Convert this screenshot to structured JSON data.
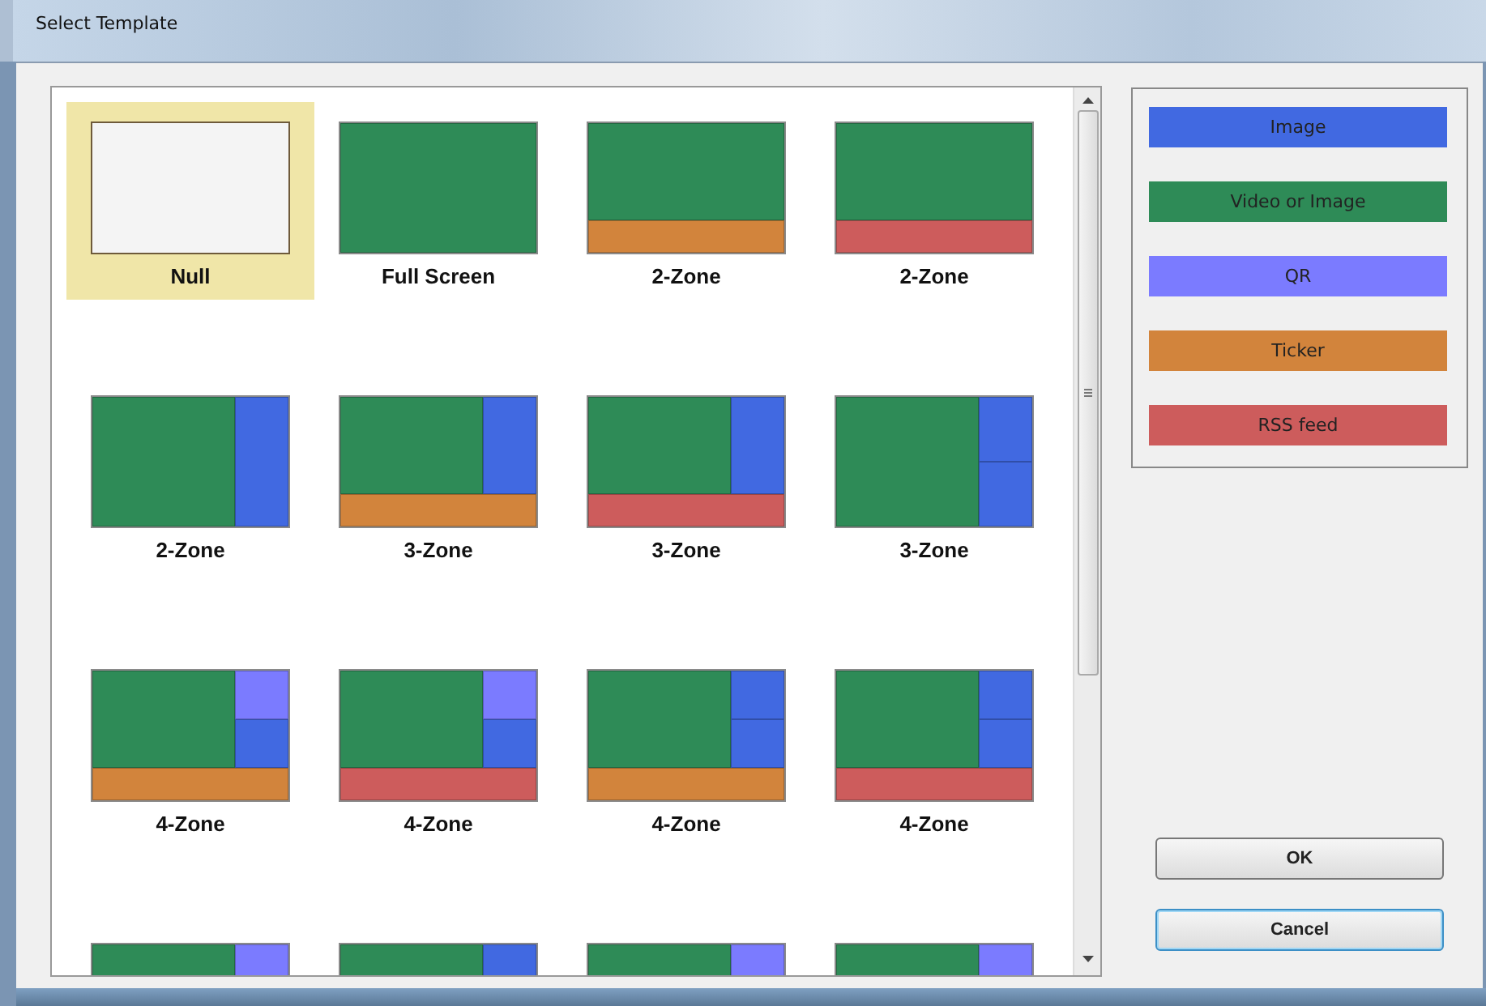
{
  "window": {
    "title": "Select Template"
  },
  "templates": [
    {
      "label": "Null",
      "selected": true,
      "kind": "empty"
    },
    {
      "label": "Full Screen",
      "selected": false,
      "kind": "full",
      "zones": [
        {
          "color": "#2e8b57"
        }
      ]
    },
    {
      "label": "2-Zone",
      "selected": false,
      "kind": "bottom",
      "zones": [
        {
          "color": "#2e8b57"
        },
        {
          "color": "#d2843c"
        }
      ]
    },
    {
      "label": "2-Zone",
      "selected": false,
      "kind": "bottom",
      "zones": [
        {
          "color": "#2e8b57"
        },
        {
          "color": "#cd5c5c"
        }
      ]
    },
    {
      "label": "2-Zone",
      "selected": false,
      "kind": "right",
      "zones": [
        {
          "color": "#2e8b57"
        },
        {
          "color": "#4169e1"
        }
      ]
    },
    {
      "label": "3-Zone",
      "selected": false,
      "kind": "rightbottom",
      "zones": [
        {
          "color": "#2e8b57"
        },
        {
          "color": "#4169e1"
        },
        {
          "color": "#d2843c"
        }
      ]
    },
    {
      "label": "3-Zone",
      "selected": false,
      "kind": "rightbottom",
      "zones": [
        {
          "color": "#2e8b57"
        },
        {
          "color": "#4169e1"
        },
        {
          "color": "#cd5c5c"
        }
      ]
    },
    {
      "label": "3-Zone",
      "selected": false,
      "kind": "splitright",
      "zones": [
        {
          "color": "#2e8b57"
        },
        {
          "color": "#4169e1"
        },
        {
          "color": "#4169e1"
        }
      ]
    },
    {
      "label": "4-Zone",
      "selected": false,
      "kind": "quad",
      "zones": [
        {
          "color": "#2e8b57"
        },
        {
          "color": "#7b7bff"
        },
        {
          "color": "#4169e1"
        },
        {
          "color": "#d2843c"
        }
      ]
    },
    {
      "label": "4-Zone",
      "selected": false,
      "kind": "quad",
      "zones": [
        {
          "color": "#2e8b57"
        },
        {
          "color": "#7b7bff"
        },
        {
          "color": "#4169e1"
        },
        {
          "color": "#cd5c5c"
        }
      ]
    },
    {
      "label": "4-Zone",
      "selected": false,
      "kind": "quad",
      "zones": [
        {
          "color": "#2e8b57"
        },
        {
          "color": "#4169e1"
        },
        {
          "color": "#4169e1"
        },
        {
          "color": "#d2843c"
        }
      ]
    },
    {
      "label": "4-Zone",
      "selected": false,
      "kind": "quad",
      "zones": [
        {
          "color": "#2e8b57"
        },
        {
          "color": "#4169e1"
        },
        {
          "color": "#4169e1"
        },
        {
          "color": "#cd5c5c"
        }
      ]
    },
    {
      "selected": false,
      "kind": "right",
      "zones": [
        {
          "color": "#2e8b57"
        },
        {
          "color": "#7b7bff"
        }
      ]
    },
    {
      "selected": false,
      "kind": "right",
      "zones": [
        {
          "color": "#2e8b57"
        },
        {
          "color": "#4169e1"
        }
      ]
    },
    {
      "selected": false,
      "kind": "right",
      "zones": [
        {
          "color": "#2e8b57"
        },
        {
          "color": "#7b7bff"
        }
      ]
    },
    {
      "selected": false,
      "kind": "right",
      "zones": [
        {
          "color": "#2e8b57"
        },
        {
          "color": "#7b7bff"
        }
      ]
    }
  ],
  "legend": [
    {
      "label": "Image",
      "color": "#4169e1"
    },
    {
      "label": "Video or Image",
      "color": "#2e8b57"
    },
    {
      "label": "QR",
      "color": "#7b7bff"
    },
    {
      "label": "Ticker",
      "color": "#d2843c"
    },
    {
      "label": "RSS feed",
      "color": "#cd5c5c"
    }
  ],
  "buttons": [
    {
      "label": "OK",
      "focused": false
    },
    {
      "label": "Cancel",
      "focused": true
    }
  ]
}
